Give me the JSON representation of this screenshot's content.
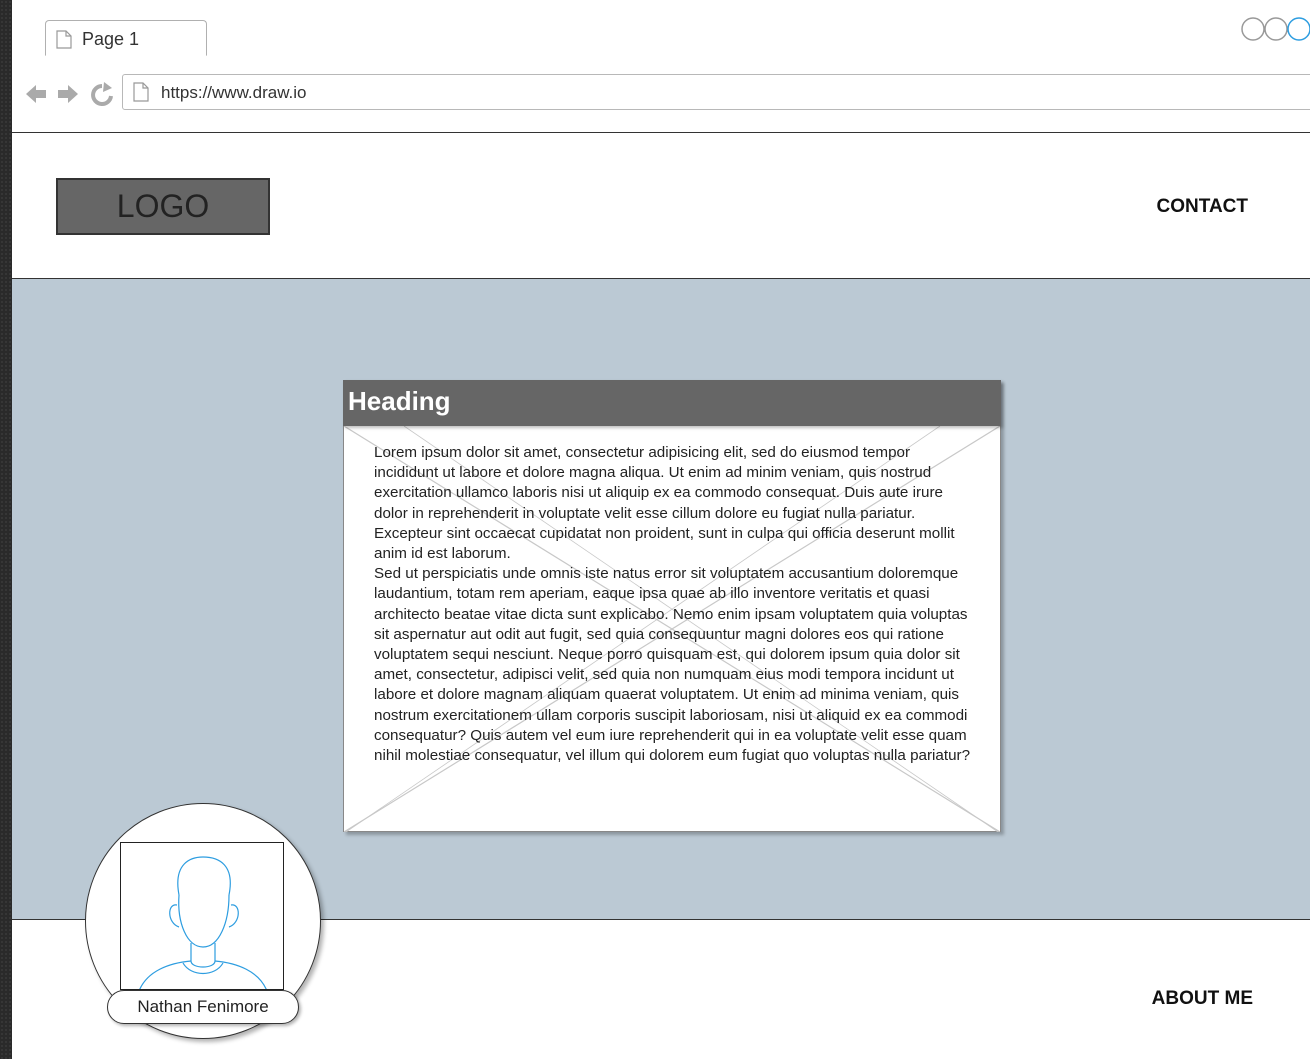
{
  "browser": {
    "tab_label": "Page 1",
    "url": "https://www.draw.io"
  },
  "header": {
    "logo": "LOGO",
    "nav_contact": "CONTACT"
  },
  "card": {
    "heading": "Heading",
    "paragraph1": "Lorem ipsum dolor sit amet, consectetur adipisicing elit, sed do eiusmod tempor incididunt ut labore et dolore magna aliqua. Ut enim ad minim veniam, quis nostrud exercitation ullamco laboris nisi ut aliquip ex ea commodo consequat. Duis aute irure dolor in reprehenderit in voluptate velit esse cillum dolore eu fugiat nulla pariatur. Excepteur sint occaecat cupidatat non proident, sunt in culpa qui officia deserunt mollit anim id est laborum.",
    "paragraph2": "Sed ut perspiciatis unde omnis iste natus error sit voluptatem accusantium doloremque laudantium, totam rem aperiam, eaque ipsa quae ab illo inventore veritatis et quasi architecto beatae vitae dicta sunt explicabo. Nemo enim ipsam voluptatem quia voluptas sit aspernatur aut odit aut fugit, sed quia consequuntur magni dolores eos qui ratione voluptatem sequi nesciunt. Neque porro quisquam est, qui dolorem ipsum quia dolor sit amet, consectetur, adipisci velit, sed quia non numquam eius modi tempora incidunt ut labore et dolore magnam aliquam quaerat voluptatem. Ut enim ad minima veniam, quis nostrum exercitationem ullam corporis suscipit laboriosam, nisi ut aliquid ex ea commodi consequatur? Quis autem vel eum iure reprehenderit qui in ea voluptate velit esse quam nihil molestiae consequatur, vel illum qui dolorem eum fugiat quo voluptas nulla pariatur?"
  },
  "profile": {
    "name": "Nathan Fenimore"
  },
  "footer": {
    "nav_about": "ABOUT ME"
  },
  "colors": {
    "hero_background": "#bbc9d4",
    "heading_bar": "#666666",
    "logo_fill": "#666666",
    "avatar_stroke": "#2d9de0"
  },
  "icons": [
    "page-icon",
    "back-arrow-icon",
    "forward-arrow-icon",
    "reload-icon",
    "window-controls-icon",
    "user-avatar-icon"
  ]
}
